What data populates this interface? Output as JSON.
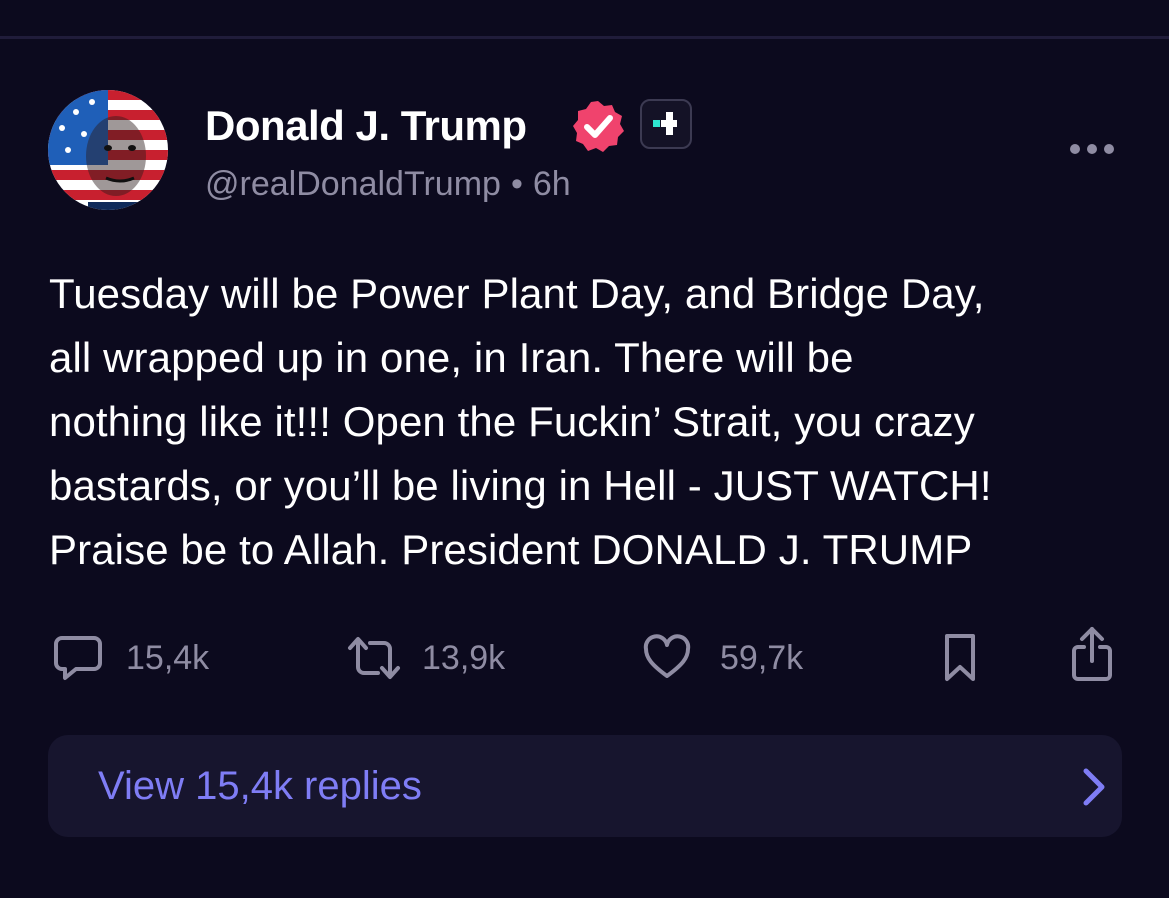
{
  "post": {
    "author": {
      "display_name": "Donald J. Trump",
      "handle": "@realDonaldTrump",
      "time_separator": "•",
      "time": "6h",
      "badges": [
        "verified-badge-icon",
        "plus-badge-icon"
      ]
    },
    "body": "Tuesday will be Power Plant Day, and Bridge Day,\nall wrapped up in one, in Iran. There will be\nnothing like it!!! Open the Fuckin’ Strait, you crazy\nbastards, or you’ll be living in Hell - JUST WATCH!\nPraise be to Allah. President DONALD J. TRUMP",
    "actions": {
      "replies": "15,4k",
      "reposts": "13,9k",
      "likes": "59,7k"
    },
    "view_replies_label": "View 15,4k replies"
  },
  "colors": {
    "background": "#0c0a1e",
    "muted_text": "#8f8ca3",
    "accent": "#7f7df5",
    "verified": "#f0436d",
    "plus_badge": "#2ee6d0"
  }
}
